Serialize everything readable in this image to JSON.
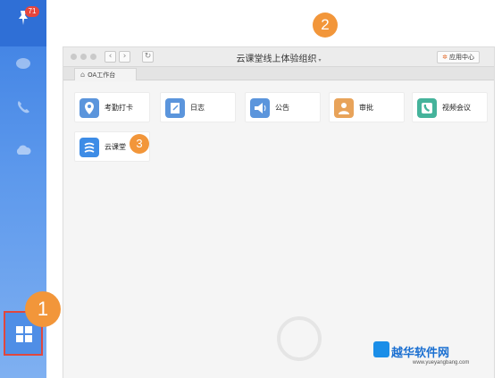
{
  "sidebar": {
    "notification_count": "71",
    "icons": [
      "pin-icon",
      "chat-icon",
      "phone-icon",
      "cloud-icon",
      "apps-grid-icon"
    ]
  },
  "markers": {
    "m1": "1",
    "m2": "2",
    "m3": "3"
  },
  "window": {
    "title": "云课堂线上体验组织",
    "title_caret": "▾",
    "app_center": "应用中心",
    "nav_back": "‹",
    "nav_forward": "›",
    "refresh": "↻"
  },
  "tab": {
    "label": "OA工作台"
  },
  "apps": [
    {
      "label": "考勤打卡",
      "icon": "location-pin-icon",
      "color": "#5b95dc"
    },
    {
      "label": "日志",
      "icon": "edit-note-icon",
      "color": "#5b95dc"
    },
    {
      "label": "公告",
      "icon": "megaphone-icon",
      "color": "#5b95dc"
    },
    {
      "label": "审批",
      "icon": "person-icon",
      "color": "#e8a35a"
    },
    {
      "label": "视频会议",
      "icon": "phone-video-icon",
      "color": "#45b39b"
    },
    {
      "label": "云课堂",
      "icon": "cloud-classroom-icon",
      "color": "#3d8ce6"
    }
  ],
  "watermark": {
    "site": "越华软件网",
    "url": "www.yueyangbang.com"
  }
}
